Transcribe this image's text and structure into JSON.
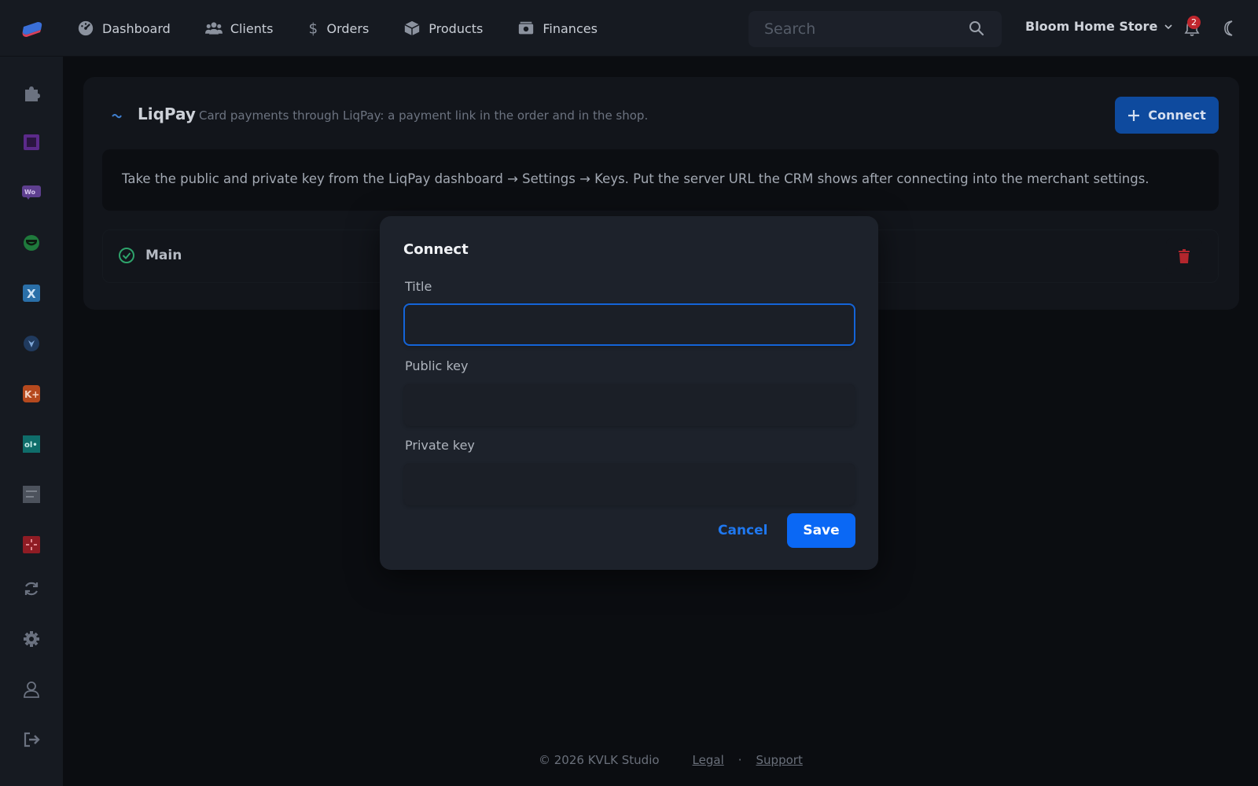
{
  "nav": {
    "items": [
      {
        "label": "Dashboard",
        "icon": "dashboard-gauge-icon"
      },
      {
        "label": "Clients",
        "icon": "users-icon"
      },
      {
        "label": "Orders",
        "icon": "dollar-icon"
      },
      {
        "label": "Products",
        "icon": "box-icon"
      },
      {
        "label": "Finances",
        "icon": "money-icon"
      }
    ],
    "search_placeholder": "Search",
    "store_name": "Bloom Home Store",
    "notification_count": "2"
  },
  "sidebar": {
    "icons": [
      "puzzle-icon",
      "square-app-icon",
      "woo-icon",
      "green-app-icon",
      "x-app-icon",
      "shield-app-icon",
      "k-plus-app-icon",
      "olx-app-icon",
      "gray-app-icon",
      "red-app-icon",
      "refresh-icon",
      "settings-icon",
      "user-icon",
      "logout-icon"
    ]
  },
  "integration": {
    "title": "LiqPay",
    "description": "Card payments through LiqPay: a payment link in the order and in the shop.",
    "connect_label": "Connect",
    "info": "Take the public and private key from the LiqPay dashboard → Settings → Keys. Put the server URL the CRM shows after connecting into the merchant settings.",
    "connection_name": "Main"
  },
  "modal": {
    "title": "Connect",
    "fields": [
      {
        "label": "Title",
        "value": ""
      },
      {
        "label": "Public key",
        "value": ""
      },
      {
        "label": "Private key",
        "value": ""
      }
    ],
    "cancel_label": "Cancel",
    "save_label": "Save"
  },
  "footer": {
    "copyright": "© 2026 KVLK Studio",
    "legal": "Legal",
    "separator": "·",
    "support": "Support"
  },
  "colors": {
    "accent": "#0a68f5",
    "background": "#0b0d11",
    "surface": "#161a21",
    "modal": "#1d222b",
    "danger": "#c0262d",
    "success": "#2ea36b"
  }
}
